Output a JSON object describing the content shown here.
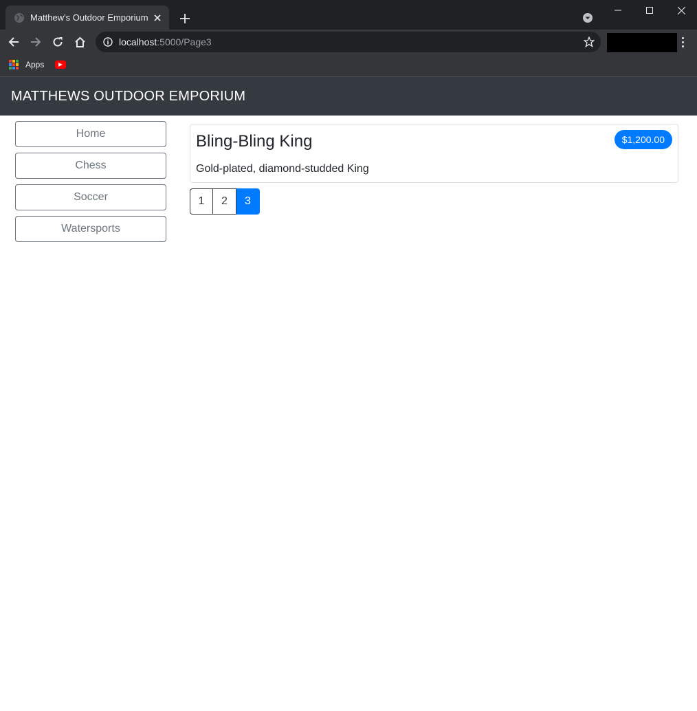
{
  "browser": {
    "tab_title": "Matthew's Outdoor Emporium",
    "url_host": "localhost",
    "url_path": ":5000/Page3",
    "bookmarks": {
      "apps_label": "Apps"
    }
  },
  "site": {
    "brand": "MATTHEWS OUTDOOR EMPORIUM"
  },
  "sidebar": {
    "categories": [
      {
        "label": "Home"
      },
      {
        "label": "Chess"
      },
      {
        "label": "Soccer"
      },
      {
        "label": "Watersports"
      }
    ]
  },
  "products": [
    {
      "name": "Bling-Bling King",
      "price": "$1,200.00",
      "description": "Gold-plated, diamond-studded King"
    }
  ],
  "pagination": {
    "pages": [
      {
        "label": "1"
      },
      {
        "label": "2"
      },
      {
        "label": "3"
      }
    ],
    "current": "3"
  },
  "colors": {
    "accent": "#007bff",
    "header_bg": "#343a40",
    "category_border": "#6c757d"
  }
}
